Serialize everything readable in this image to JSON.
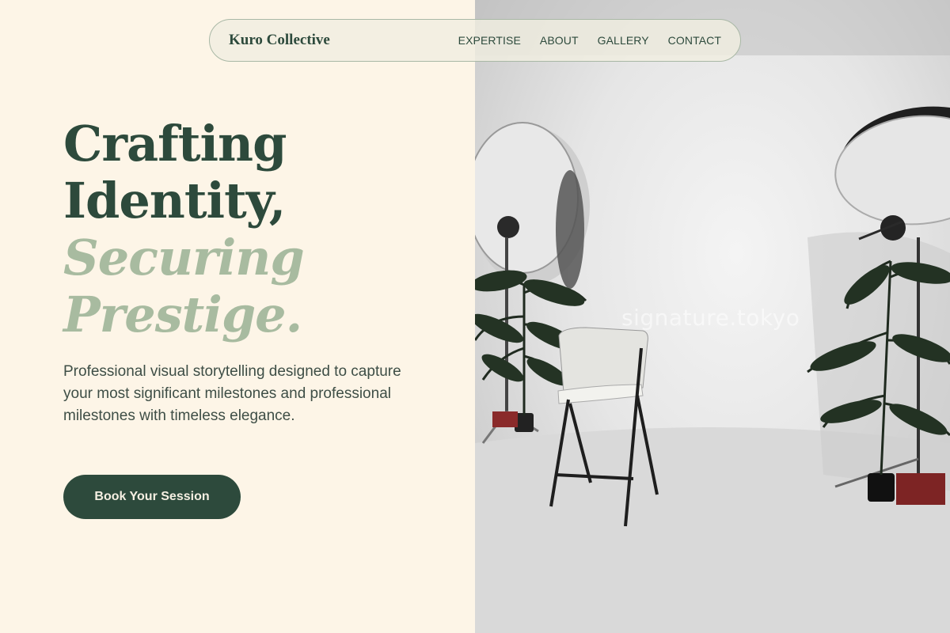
{
  "nav": {
    "brand": "Kuro Collective",
    "links": [
      "EXPERTISE",
      "ABOUT",
      "GALLERY",
      "CONTACT"
    ]
  },
  "hero": {
    "headline_line1": "Crafting",
    "headline_line2": "Identity,",
    "headline_line3": "Securing",
    "headline_line4": "Prestige.",
    "subtitle": "Professional visual storytelling designed to capture your most significant milestones and professional milestones with timeless elegance.",
    "cta_label": "Book Your Session"
  },
  "photo": {
    "watermark": "signature.tokyo",
    "subject": "photo-studio-with-softbox-lights-stool-and-palm-plants"
  },
  "colors": {
    "background": "#fdf5e7",
    "primary": "#2d4a3c",
    "accent": "#a8bba0",
    "body_text": "#3e4e46"
  }
}
